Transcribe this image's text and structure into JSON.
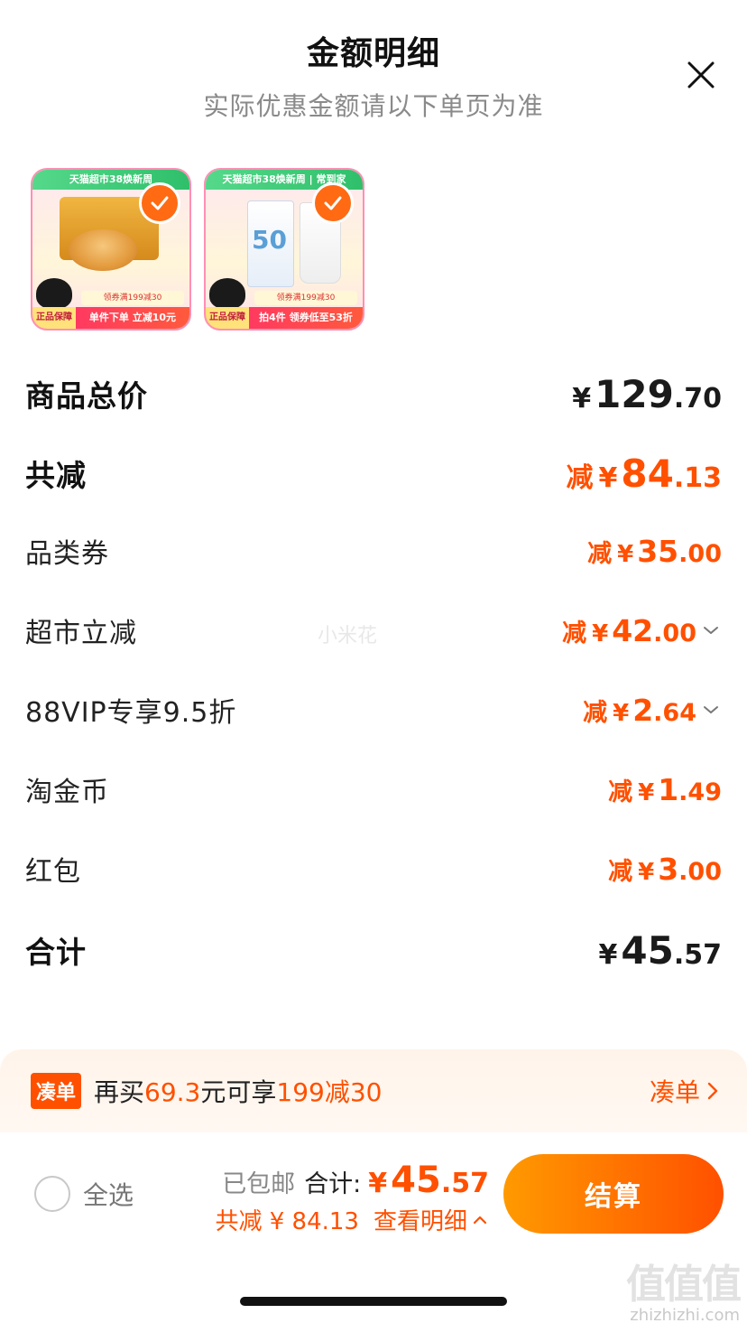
{
  "header": {
    "title": "金额明细",
    "subtitle": "实际优惠金额请以下单页为准"
  },
  "products": [
    {
      "banner": "天猫超市38焕新周",
      "info": "领券满199减30",
      "tag": "正品保障",
      "bottom_text": "单件下单 立减10元",
      "selected": true
    },
    {
      "banner": "天猫超市38焕新周 | 常到家",
      "info": "领券满199减30",
      "tag": "正品保障",
      "bottom_text": "拍4件 领券低至53折",
      "package_number": "50",
      "selected": true
    }
  ],
  "rows": {
    "goods_total": {
      "label": "商品总价",
      "yen": "¥",
      "int": "129",
      "dec": ".70"
    },
    "total_discount": {
      "label": "共减",
      "prefix": "减",
      "yen": "¥",
      "int": "84",
      "dec": ".13"
    },
    "category_coupon": {
      "label": "品类券",
      "prefix": "减",
      "yen": "¥",
      "int": "35",
      "dec": ".00"
    },
    "supermarket_discount": {
      "label": "超市立减",
      "prefix": "减",
      "yen": "¥",
      "int": "42",
      "dec": ".00"
    },
    "vip_discount": {
      "label": "88VIP专享9.5折",
      "prefix": "减",
      "yen": "¥",
      "int": "2",
      "dec": ".64"
    },
    "taojinbi": {
      "label": "淘金币",
      "prefix": "减",
      "yen": "¥",
      "int": "1",
      "dec": ".49"
    },
    "red_packet": {
      "label": "红包",
      "prefix": "减",
      "yen": "¥",
      "int": "3",
      "dec": ".00"
    },
    "grand_total": {
      "label": "合计",
      "yen": "¥",
      "int": "45",
      "dec": ".57"
    }
  },
  "watermark_text": "小米花",
  "promo": {
    "tag": "凑单",
    "text_pre": "再买",
    "amount": "69.3",
    "text_mid": "元可享",
    "offer": "199减30",
    "link": "凑单"
  },
  "footer": {
    "select_all": "全选",
    "shipping": "已包邮",
    "total_label": "合计:",
    "total_yen": "¥",
    "total_int": "45",
    "total_dec": ".57",
    "discount_text": "共减 ¥ 84.13",
    "detail_link": "查看明细",
    "checkout": "结算"
  },
  "watermark_logo": {
    "mark": "值值值",
    "url": "zhizhizhi.com"
  },
  "colors": {
    "accent": "#ff5000",
    "accent_gradient_start": "#ff9a00",
    "promo_bg": "#fff4ea"
  }
}
